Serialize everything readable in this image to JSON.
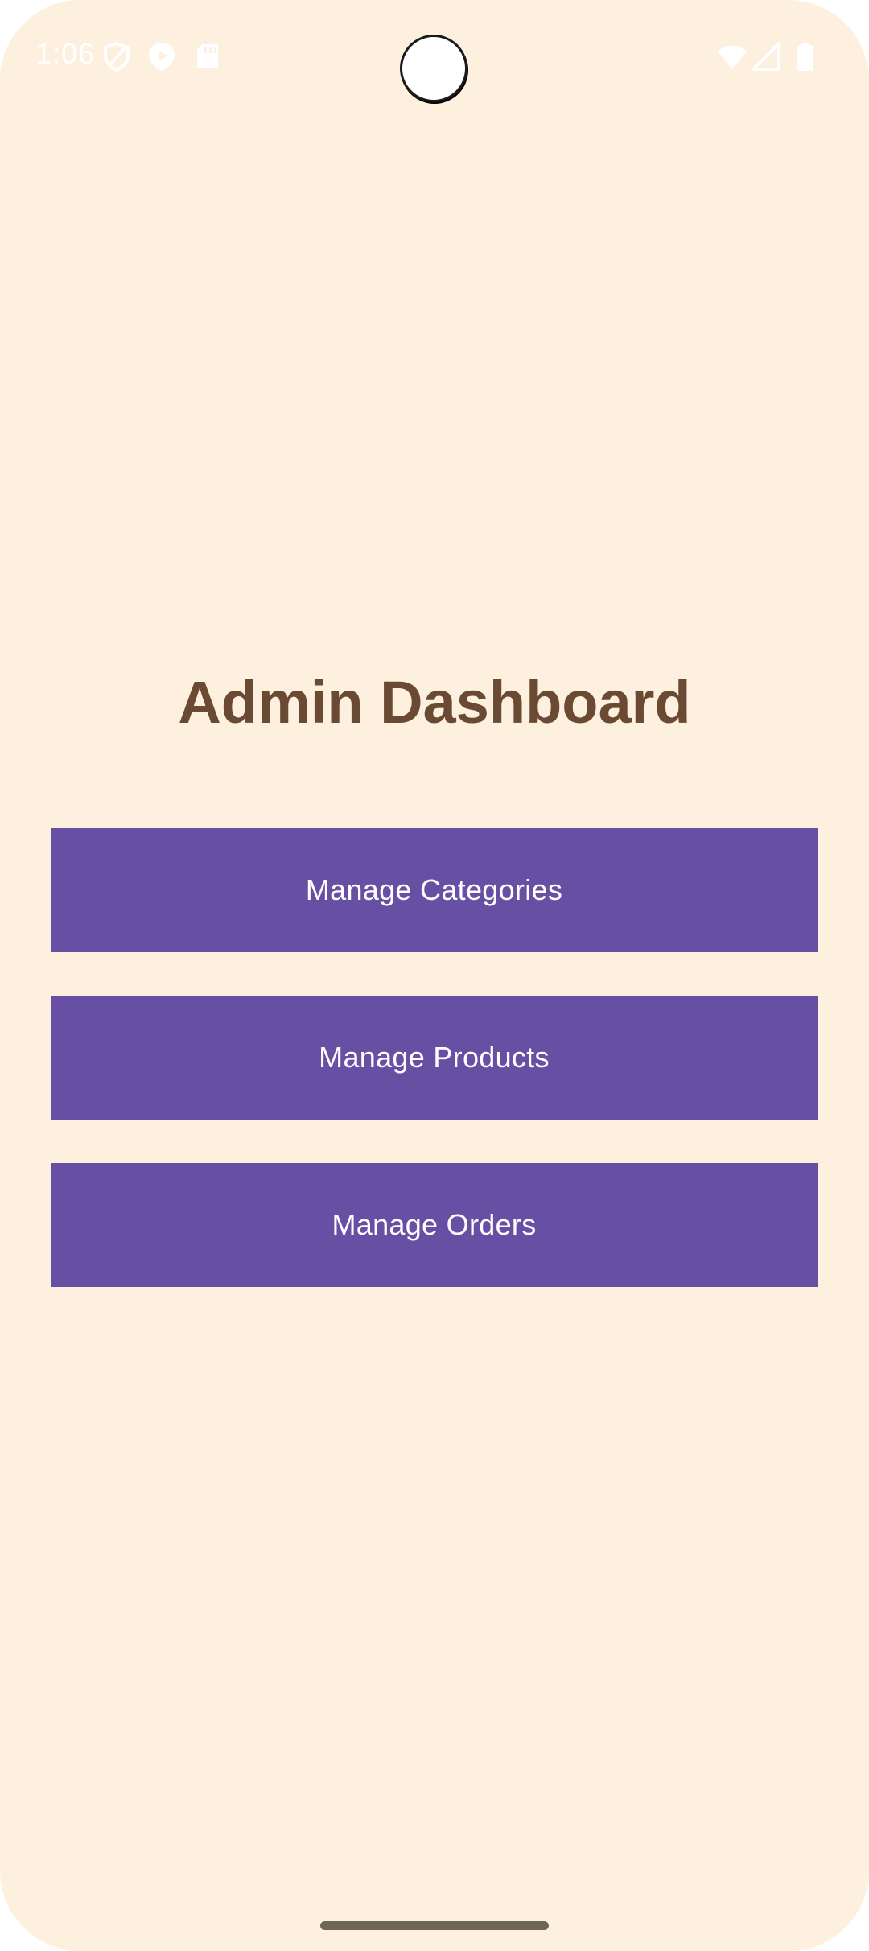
{
  "status_bar": {
    "time": "1:06",
    "icons_left": [
      "shield-icon",
      "play-icon",
      "sd-card-icon"
    ],
    "icons_right": [
      "wifi-icon",
      "signal-icon",
      "battery-icon"
    ]
  },
  "main": {
    "title": "Admin Dashboard",
    "buttons": [
      {
        "label": "Manage Categories"
      },
      {
        "label": "Manage Products"
      },
      {
        "label": "Manage Orders"
      }
    ]
  },
  "colors": {
    "background": "#fdf0de",
    "title": "#6b4a33",
    "button": "#6750a4",
    "button_text": "#ffffff"
  }
}
